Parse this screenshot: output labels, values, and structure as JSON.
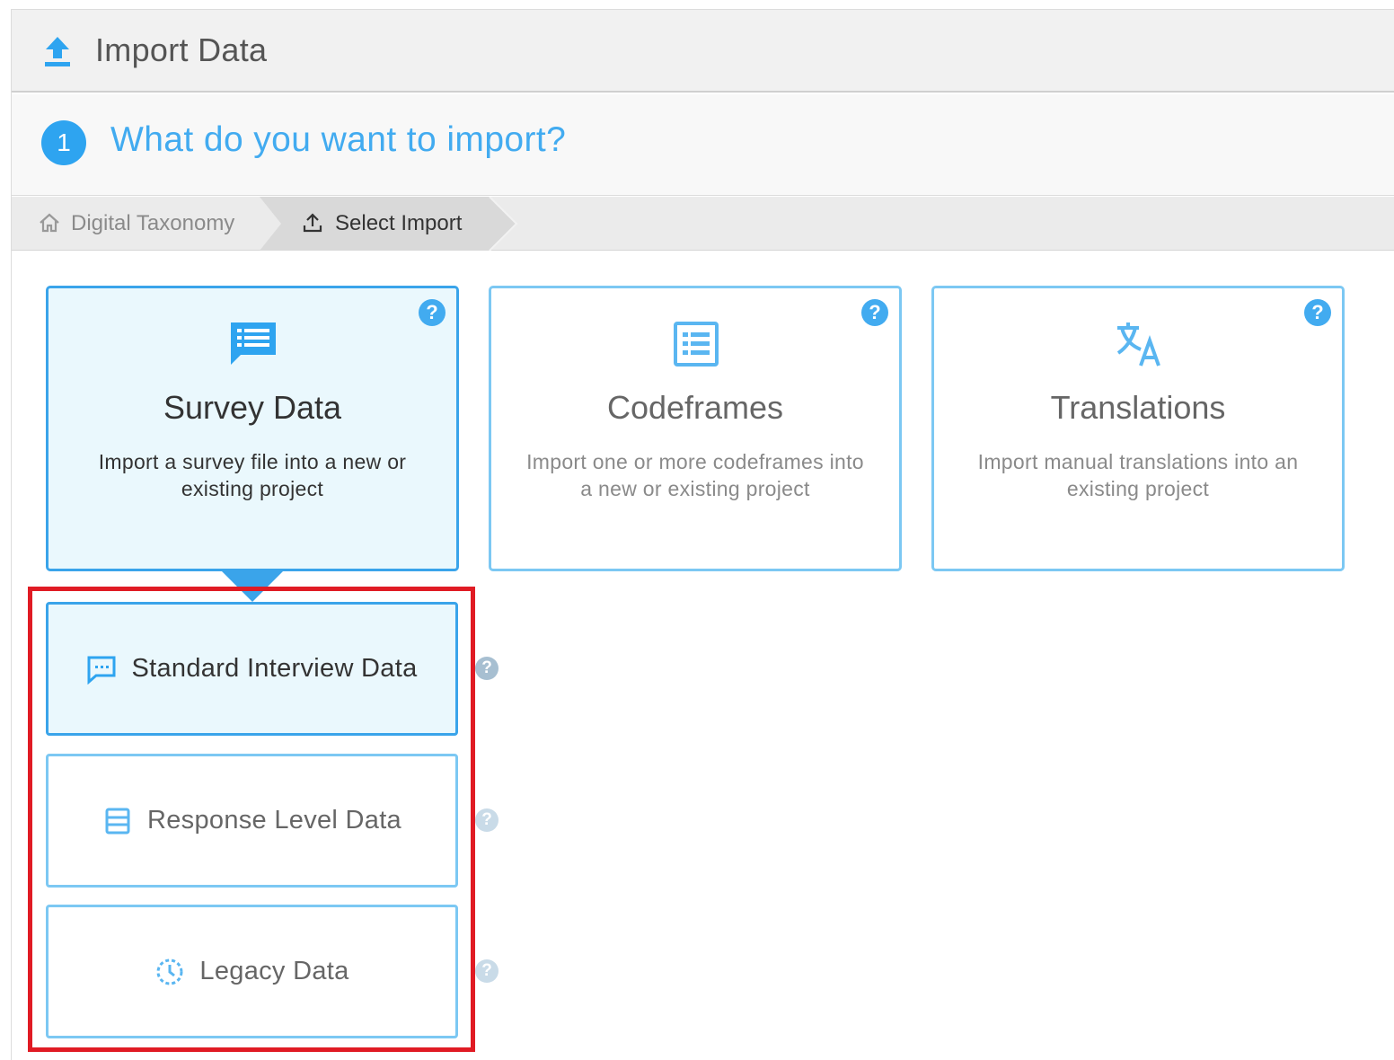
{
  "header": {
    "title": "Import Data",
    "icon": "upload-icon"
  },
  "step": {
    "number": "1",
    "question": "What do you want to import?"
  },
  "breadcrumb": {
    "items": [
      {
        "label": "Digital Taxonomy",
        "icon": "home-icon"
      },
      {
        "label": "Select Import",
        "icon": "upload-icon"
      }
    ]
  },
  "cards": [
    {
      "title": "Survey Data",
      "description": "Import a survey file into a new or existing project",
      "icon": "survey-chat-icon",
      "help": "?",
      "selected": true
    },
    {
      "title": "Codeframes",
      "description": "Import one or more codeframes into a new or existing project",
      "icon": "list-icon",
      "help": "?",
      "selected": false
    },
    {
      "title": "Translations",
      "description": "Import manual translations into an existing project",
      "icon": "translate-icon",
      "help": "?",
      "selected": false
    }
  ],
  "options": [
    {
      "label": "Standard Interview Data",
      "icon": "chat-dots-icon",
      "help": "?",
      "selected": true
    },
    {
      "label": "Response Level Data",
      "icon": "rows-icon",
      "help": "?",
      "selected": false
    },
    {
      "label": "Legacy Data",
      "icon": "clock-icon",
      "help": "?",
      "selected": false
    }
  ],
  "colors": {
    "accent": "#2ea4f0",
    "highlight": "#e01b24",
    "selected_bg": "#eaf8fd"
  }
}
